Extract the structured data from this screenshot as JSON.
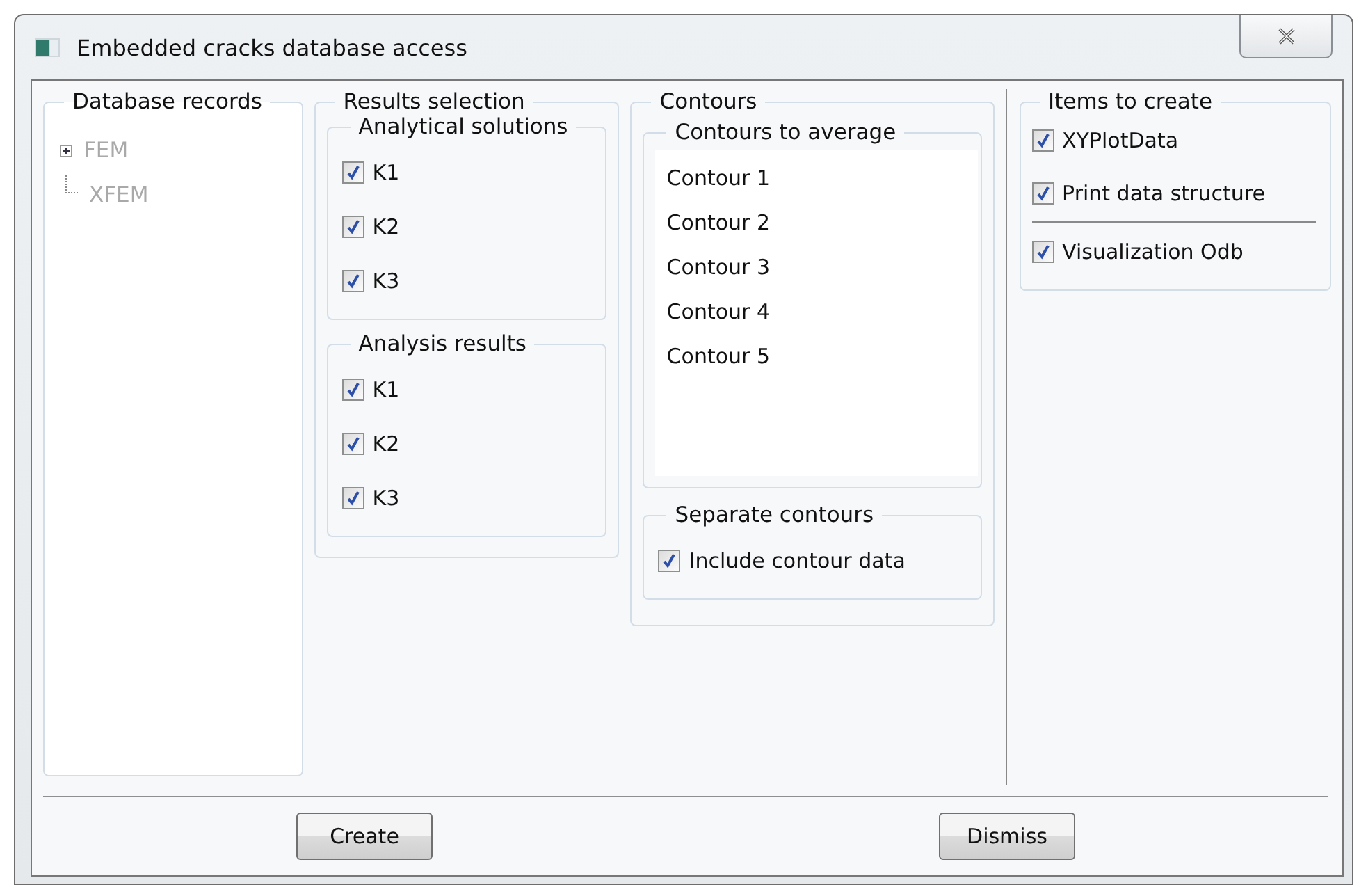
{
  "window": {
    "title": "Embedded cracks database access"
  },
  "database_records": {
    "title": "Database records",
    "items": [
      {
        "label": "FEM",
        "expanded": false,
        "disabled": true
      },
      {
        "label": "XFEM",
        "disabled": true
      }
    ]
  },
  "results_selection": {
    "title": "Results selection",
    "groups": [
      {
        "title": "Analytical solutions",
        "options": [
          {
            "label": "K1",
            "checked": true
          },
          {
            "label": "K2",
            "checked": true
          },
          {
            "label": "K3",
            "checked": true
          }
        ]
      },
      {
        "title": "Analysis results",
        "options": [
          {
            "label": "K1",
            "checked": true
          },
          {
            "label": "K2",
            "checked": true
          },
          {
            "label": "K3",
            "checked": true
          }
        ]
      }
    ]
  },
  "contours": {
    "title": "Contours",
    "average": {
      "title": "Contours to average",
      "items": [
        {
          "label": "Contour 1",
          "selected": false
        },
        {
          "label": "Contour 2",
          "selected": false
        },
        {
          "label": "Contour 3",
          "selected": false
        },
        {
          "label": "Contour 4",
          "selected": false
        },
        {
          "label": "Contour 5",
          "selected": false
        }
      ]
    },
    "separate": {
      "title": "Separate contours",
      "options": [
        {
          "label": "Include contour data",
          "checked": true
        }
      ]
    }
  },
  "items_to_create": {
    "title": "Items to create",
    "sections": [
      {
        "options": [
          {
            "label": "XYPlotData",
            "checked": true
          },
          {
            "label": "Print data structure",
            "checked": true
          }
        ]
      },
      {
        "options": [
          {
            "label": "Visualization Odb",
            "checked": true
          }
        ]
      }
    ]
  },
  "buttons": [
    {
      "label": "Create"
    },
    {
      "label": "Dismiss"
    }
  ]
}
